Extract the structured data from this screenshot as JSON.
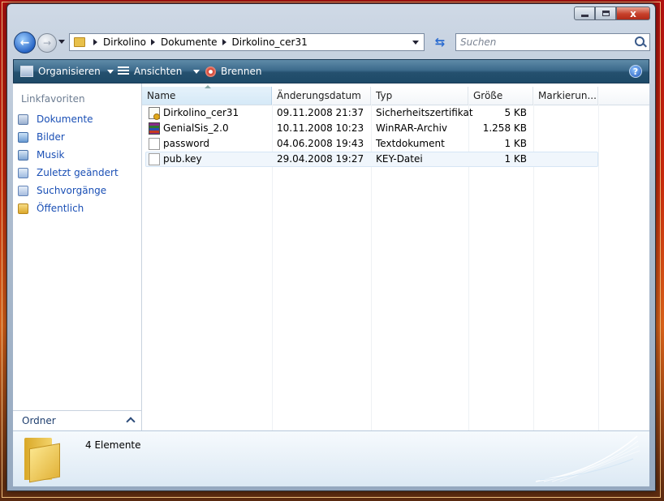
{
  "window": {
    "caption": {
      "close_glyph": "x"
    }
  },
  "address": {
    "crumbs": [
      "Dirkolino",
      "Dokumente",
      "Dirkolino_cer31"
    ]
  },
  "search": {
    "placeholder": "Suchen"
  },
  "toolbar": {
    "organize": "Organisieren",
    "views": "Ansichten",
    "burn": "Brennen",
    "help": "?"
  },
  "nav_pane": {
    "heading": "Linkfavoriten",
    "items": [
      {
        "label": "Dokumente",
        "icon": "documents-icon"
      },
      {
        "label": "Bilder",
        "icon": "pictures-icon"
      },
      {
        "label": "Musik",
        "icon": "music-icon"
      },
      {
        "label": "Zuletzt geändert",
        "icon": "recently-changed-icon"
      },
      {
        "label": "Suchvorgänge",
        "icon": "searches-icon"
      },
      {
        "label": "Öffentlich",
        "icon": "public-folder-icon"
      }
    ],
    "folders_label": "Ordner"
  },
  "columns": {
    "name": "Name",
    "date": "Änderungsdatum",
    "type": "Typ",
    "size": "Größe",
    "tags": "Markierun..."
  },
  "files": [
    {
      "name": "Dirkolino_cer31",
      "date": "09.11.2008 21:37",
      "type": "Sicherheitszertifikat",
      "size": "5 KB",
      "icon": "certificate-icon"
    },
    {
      "name": "GenialSis_2.0",
      "date": "10.11.2008 10:23",
      "type": "WinRAR-Archiv",
      "size": "1.258 KB",
      "icon": "winrar-archive-icon"
    },
    {
      "name": "password",
      "date": "04.06.2008 19:43",
      "type": "Textdokument",
      "size": "1 KB",
      "icon": "text-document-icon"
    },
    {
      "name": "pub.key",
      "date": "29.04.2008 19:27",
      "type": "KEY-Datei",
      "size": "1 KB",
      "icon": "key-file-icon"
    }
  ],
  "details": {
    "count": "4 Elemente"
  },
  "colors": {
    "toolbar": "#2b5a7c",
    "link": "#1a4fb5",
    "desktop": "#c82a0c"
  }
}
